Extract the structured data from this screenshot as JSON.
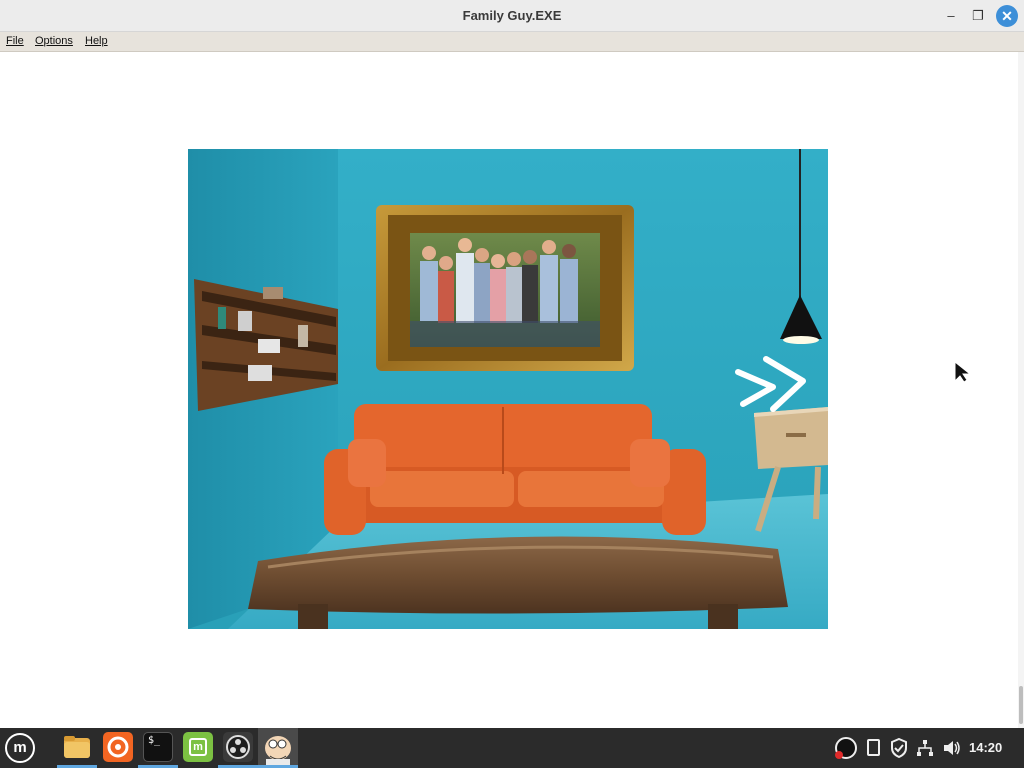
{
  "window": {
    "title": "Family Guy.EXE",
    "controls": {
      "minimize": "–",
      "maximize": "❐",
      "close": "✕"
    }
  },
  "menu": {
    "file": "File",
    "options": "Options",
    "help": "Help"
  },
  "scene": {
    "next_arrow": ">>",
    "objects": [
      "wall-shelf",
      "framed-family-photo",
      "orange-sofa",
      "wooden-coffee-table",
      "pendant-lamp",
      "side-table"
    ]
  },
  "taskbar": {
    "menu_icon": "mint-logo-icon",
    "apps": [
      "files-icon",
      "firefox-icon",
      "terminal-icon",
      "mint-update-icon",
      "obs-icon",
      "family-guy-icon"
    ],
    "terminal_glyph": "$_",
    "tray": [
      "obs-tray-icon",
      "clipboard-icon",
      "shield-icon",
      "network-icon",
      "volume-icon"
    ],
    "clock": "14:20"
  },
  "colors": {
    "accent": "#3d8fd8",
    "wall": "#2aa6bf",
    "sofa": "#e4662d",
    "taskbar": "#2b2b2b"
  }
}
